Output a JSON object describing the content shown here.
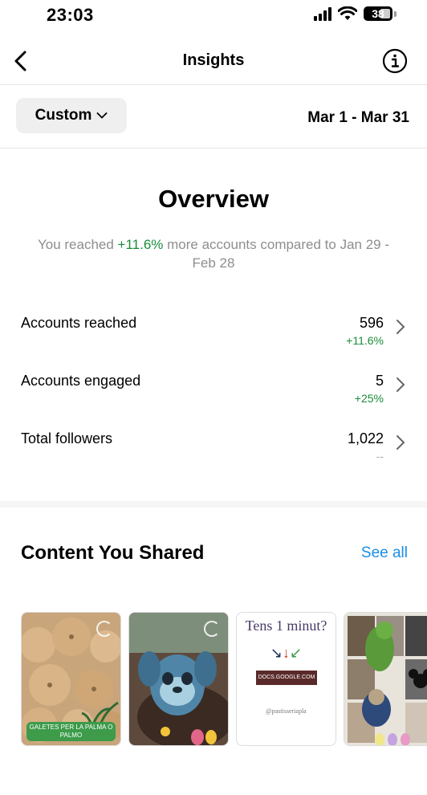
{
  "status_bar": {
    "time": "23:03",
    "battery_level": "38"
  },
  "header": {
    "title": "Insights"
  },
  "filter": {
    "preset_label": "Custom",
    "date_range": "Mar 1 - Mar 31"
  },
  "overview": {
    "title": "Overview",
    "summary_prefix": "You reached ",
    "summary_highlight": "+11.6%",
    "summary_suffix": " more accounts compared to Jan 29 - Feb 28"
  },
  "metrics": [
    {
      "label": "Accounts reached",
      "value": "596",
      "change": "+11.6%"
    },
    {
      "label": "Accounts engaged",
      "value": "5",
      "change": "+25%"
    },
    {
      "label": "Total followers",
      "value": "1,022",
      "change": "--"
    }
  ],
  "content": {
    "title": "Content You Shared",
    "see_all": "See all",
    "thumbnails": [
      {
        "caption": "GALETES PER LA PALMA O PALMO"
      },
      {
        "caption": ""
      },
      {
        "title": "Tens 1 minut?",
        "link_text": "DOCS.GOOGLE.COM",
        "handle": "@pastisseriapla"
      },
      {
        "caption": ""
      }
    ]
  },
  "colors": {
    "positive": "#1a8c3a",
    "link": "#1a8ee6",
    "muted": "#8e8e8e"
  }
}
